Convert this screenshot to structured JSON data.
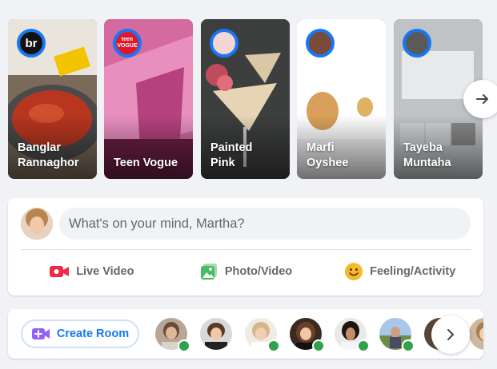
{
  "stories": [
    {
      "name": "Banglar\nRannaghor",
      "avatar_text": "br"
    },
    {
      "name": "Teen Vogue",
      "avatar_text": "teen VOGUE"
    },
    {
      "name": "Painted\nPink"
    },
    {
      "name": "Marfi\nOyshee"
    },
    {
      "name": "Tayeba\nMuntaha"
    }
  ],
  "story_next_icon": "arrow-right-icon",
  "composer": {
    "placeholder": "What's on your mind, Martha?",
    "actions": [
      {
        "label": "Live Video",
        "icon": "live-video-icon",
        "color": "#f02849"
      },
      {
        "label": "Photo/Video",
        "icon": "photo-video-icon",
        "color": "#45bd62"
      },
      {
        "label": "Feeling/Activity",
        "icon": "feeling-icon",
        "color": "#f7b928"
      }
    ]
  },
  "rooms": {
    "create_label": "Create Room",
    "create_icon": "video-plus-icon",
    "accent": "#1877f2",
    "online_color": "#31a24c"
  }
}
